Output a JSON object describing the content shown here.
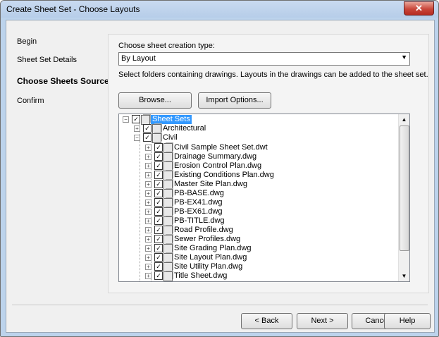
{
  "window": {
    "title": "Create Sheet Set - Choose Layouts",
    "close_glyph": "✕"
  },
  "nav": {
    "items": [
      "Begin",
      "Sheet Set Details",
      "Choose Sheets Source",
      "Confirm"
    ]
  },
  "form": {
    "creation_type_label": "Choose sheet creation type:",
    "creation_type_value": "By Layout",
    "instruction": "Select folders containing drawings. Layouts in the  drawings can be added to the sheet set.",
    "browse_label": "Browse...",
    "import_label": "Import Options..."
  },
  "tree": {
    "root": "Sheet Sets",
    "architectural": "Architectural",
    "civil": "Civil",
    "files": [
      "Civil Sample Sheet Set.dwt",
      "Drainage Summary.dwg",
      "Erosion Control Plan.dwg",
      "Existing Conditions Plan.dwg",
      "Master Site Plan.dwg",
      "PB-BASE.dwg",
      "PB-EX41.dwg",
      "PB-EX61.dwg",
      "PB-TITLE.dwg",
      "Road Profile.dwg",
      "Sewer Profiles.dwg",
      "Site Grading Plan.dwg",
      "Site Layout Plan.dwg",
      "Site Utility Plan.dwg",
      "Title Sheet.dwg"
    ]
  },
  "footer": {
    "back": "< Back",
    "next": "Next >",
    "cancel": "Cancel",
    "help": "Help"
  },
  "colors": {
    "selection": "#3399ff",
    "frame": "#bcd3ec",
    "close": "#c9463a"
  }
}
